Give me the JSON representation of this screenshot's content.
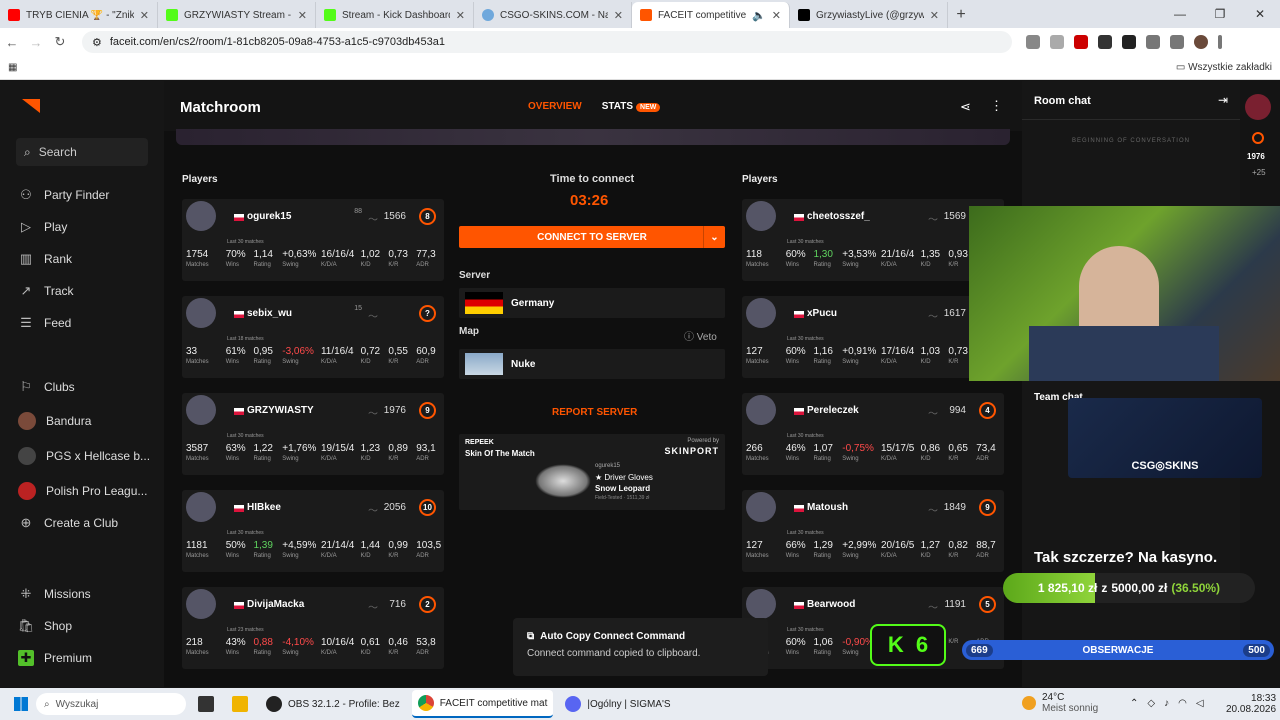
{
  "browser": {
    "tabs": [
      {
        "title": "TRYB CIENIA 🏆 - \"Zniknij na 6",
        "color": "#ff0000"
      },
      {
        "title": "GRZYWIASTY Stream - Watch Li",
        "color": "#53fc18"
      },
      {
        "title": "Stream - Kick Dashboard",
        "color": "#53fc18"
      },
      {
        "title": "CSGO-SKINS.COM - Najlepsze",
        "color": "#6fa8dc"
      },
      {
        "title": "FACEIT competitive match",
        "color": "#ff5500"
      },
      {
        "title": "GrzywiastyLive (@grzywiastylive",
        "color": "#000000"
      }
    ],
    "url": "faceit.com/en/cs2/room/1-81cb8205-09a8-4753-a1c5-c9703db453a1",
    "bookmarks_label": "Wszystkie zakładki"
  },
  "sidebar": {
    "search": "Search",
    "items": [
      "Party Finder",
      "Play",
      "Rank",
      "Track",
      "Feed"
    ],
    "clubs": [
      "Clubs",
      "Bandura",
      "PGS x Hellcase b...",
      "Polish Pro Leagu...",
      "Create a Club"
    ],
    "bottom": [
      "Missions",
      "Shop",
      "Premium"
    ]
  },
  "header": {
    "title": "Matchroom",
    "tab_overview": "OVERVIEW",
    "tab_stats": "STATS",
    "new_badge": "NEW"
  },
  "players_label": "Players",
  "last30": "Last 30 matches",
  "stat_labels": [
    "Matches",
    "Wins",
    "Rating",
    "Swing",
    "K/D/A",
    "K/D",
    "K/R",
    "ADR"
  ],
  "team1": [
    {
      "name": "ogurek15",
      "elo": "1566",
      "level": "8",
      "extra": "88",
      "last": "Last 30 matches",
      "stats": [
        "1754",
        "70%",
        "1,14",
        "+0,63%",
        "16/16/4",
        "1,02",
        "0,73",
        "77,3"
      ],
      "swing_neg": false
    },
    {
      "name": "sebix_wu",
      "elo": "",
      "level": "?",
      "extra": "15",
      "last": "Last 18 matches",
      "stats": [
        "33",
        "61%",
        "0,95",
        "-3,06%",
        "11/16/4",
        "0,72",
        "0,55",
        "60,9"
      ],
      "swing_neg": true
    },
    {
      "name": "GRZYWIASTY",
      "elo": "1976",
      "level": "9",
      "extra": "",
      "last": "Last 30 matches",
      "stats": [
        "3587",
        "63%",
        "1,22",
        "+1,76%",
        "19/15/4",
        "1,23",
        "0,89",
        "93,1"
      ],
      "swing_neg": false
    },
    {
      "name": "HIBkee",
      "elo": "2056",
      "level": "10",
      "extra": "",
      "last": "Last 30 matches",
      "stats": [
        "1181",
        "50%",
        "1,39",
        "+4,59%",
        "21/14/4",
        "1,44",
        "0,99",
        "103,5"
      ],
      "swing_neg": false
    },
    {
      "name": "DivijaMacka",
      "elo": "716",
      "level": "2",
      "extra": "",
      "last": "Last 23 matches",
      "stats": [
        "218",
        "43%",
        "0,88",
        "-4,10%",
        "10/16/4",
        "0,61",
        "0,46",
        "53,8"
      ],
      "swing_neg": true
    }
  ],
  "team2": [
    {
      "name": "cheetosszef_",
      "elo": "1569",
      "level": "",
      "extra": "",
      "last": "Last 30 matches",
      "stats": [
        "118",
        "60%",
        "1,30",
        "+3,53%",
        "21/16/4",
        "1,35",
        "0,93",
        ""
      ],
      "swing_neg": false
    },
    {
      "name": "xPucu",
      "elo": "1617",
      "level": "",
      "extra": "",
      "last": "Last 30 matches",
      "stats": [
        "127",
        "60%",
        "1,16",
        "+0,91%",
        "17/16/4",
        "1,03",
        "0,73",
        ""
      ],
      "swing_neg": false
    },
    {
      "name": "Pereleczek",
      "elo": "994",
      "level": "4",
      "extra": "",
      "last": "Last 30 matches",
      "stats": [
        "266",
        "46%",
        "1,07",
        "-0,75%",
        "15/17/5",
        "0,86",
        "0,65",
        "73,4"
      ],
      "swing_neg": true
    },
    {
      "name": "Matoush",
      "elo": "1849",
      "level": "9",
      "extra": "",
      "last": "Last 30 matches",
      "stats": [
        "127",
        "66%",
        "1,29",
        "+2,99%",
        "20/16/5",
        "1,27",
        "0,82",
        "88,7"
      ],
      "swing_neg": false
    },
    {
      "name": "Bearwood",
      "elo": "1191",
      "level": "5",
      "extra": "",
      "last": "Last 30 matches",
      "stats": [
        "218",
        "60%",
        "1,06",
        "-0,90%",
        "",
        "0,6",
        "",
        ""
      ],
      "swing_neg": true
    }
  ],
  "center": {
    "time_label": "Time to connect",
    "timer": "03:26",
    "connect": "CONNECT TO SERVER",
    "server_label": "Server",
    "server": "Germany",
    "map_label": "Map",
    "veto": "Veto",
    "map": "Nuke",
    "report": "REPORT SERVER",
    "skin": {
      "brand": "REPEEK",
      "title": "Skin Of The Match",
      "powered": "Powered by",
      "sponsor": "SKINPORT",
      "owner": "ogurek15",
      "item": "★ Driver Gloves",
      "item2": "Snow Leopard",
      "wear": "Field-Tested · 1511,39 zł"
    }
  },
  "toast": {
    "title": "Auto Copy Connect Command",
    "body": "Connect command copied to clipboard."
  },
  "chat": {
    "title": "Room chat",
    "begin": "BEGINNING OF CONVERSATION",
    "team": "Team chat",
    "rbar_elo": "1976",
    "rbar_plus": "+25"
  },
  "overlay": {
    "csgo": "CSG◎SKINS",
    "promo": "Tak szczerze? Na kasyno.",
    "progress_now": "1 825,10 zł",
    "progress_sep": "z",
    "progress_goal": "5000,00 zł",
    "progress_pct": "(36.50%)",
    "progress_fraction": 0.365,
    "obs_left": "669",
    "obs_label": "OBSERWACJE",
    "obs_right": "500",
    "kick_a": "K",
    "kick_b": "6"
  },
  "taskbar": {
    "search": "Wyszukaj",
    "obs": "OBS 32.1.2 - Profile: Bez",
    "chrome": "FACEIT competitive mat",
    "discord": "|Ogólny | SIGMA'S",
    "weather_temp": "24°C",
    "weather": "Meist sonnig",
    "time": "18:33",
    "date": "20.08.2026"
  }
}
